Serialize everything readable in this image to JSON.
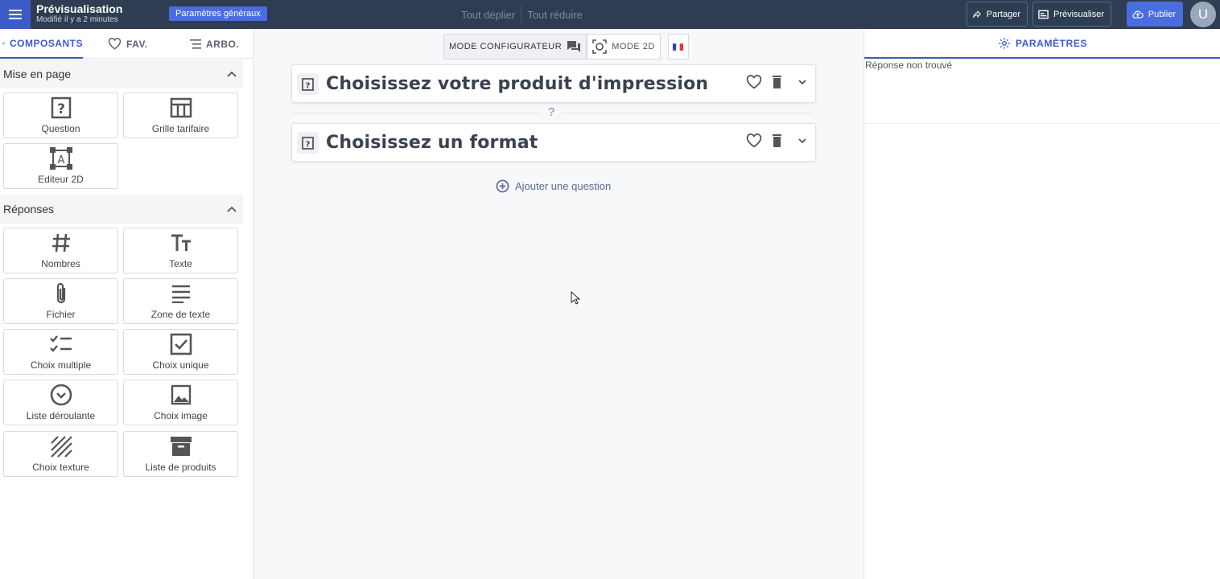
{
  "header": {
    "title": "Prévisualisation",
    "subtitle": "Modifié il y a 2 minutes",
    "settings_chip": "Paramètres généraux",
    "expand_all": "Tout déplier",
    "collapse_all": "Tout réduire",
    "share_label": "Partager",
    "preview_label": "Prévisualiser",
    "publish_label": "Publier",
    "avatar_initial": "U"
  },
  "sidebar": {
    "tabs": [
      {
        "label": "COMPOSANTS",
        "icon": "grid-icon"
      },
      {
        "label": "FAV.",
        "icon": "heart-icon"
      },
      {
        "label": "ARBO.",
        "icon": "tree-icon"
      }
    ],
    "sections": [
      {
        "title": "Mise en page",
        "items": [
          {
            "label": "Question",
            "icon": "question-box-icon"
          },
          {
            "label": "Grille tarifaire",
            "icon": "table-icon"
          },
          {
            "label": "Editeur 2D",
            "icon": "editor-2d-icon"
          }
        ]
      },
      {
        "title": "Réponses",
        "items": [
          {
            "label": "Nombres",
            "icon": "hash-icon"
          },
          {
            "label": "Texte",
            "icon": "text-icon"
          },
          {
            "label": "Fichier",
            "icon": "paperclip-icon"
          },
          {
            "label": "Zone de texte",
            "icon": "lines-icon"
          },
          {
            "label": "Choix multiple",
            "icon": "checklist-icon"
          },
          {
            "label": "Choix unique",
            "icon": "checkbox-icon"
          },
          {
            "label": "Liste déroulante",
            "icon": "dropdown-icon"
          },
          {
            "label": "Choix image",
            "icon": "image-icon"
          },
          {
            "label": "Choix texture",
            "icon": "texture-icon"
          },
          {
            "label": "Liste de produits",
            "icon": "archive-icon"
          }
        ]
      }
    ]
  },
  "main": {
    "mode_configurator": "MODE CONFIGURATEUR",
    "mode_2d": "MODE 2D",
    "questions": [
      {
        "title": "Choisissez votre produit d'impression"
      },
      {
        "title": "Choisissez un format"
      }
    ],
    "separator_mark": "?",
    "add_question": "Ajouter une question"
  },
  "right_panel": {
    "tab_label": "PARAMÈTRES",
    "message": "Réponse non trouvé"
  },
  "colors": {
    "topbar": "#2f3d52",
    "accent": "#3f59c9",
    "primary_button": "#4a6ee0"
  }
}
